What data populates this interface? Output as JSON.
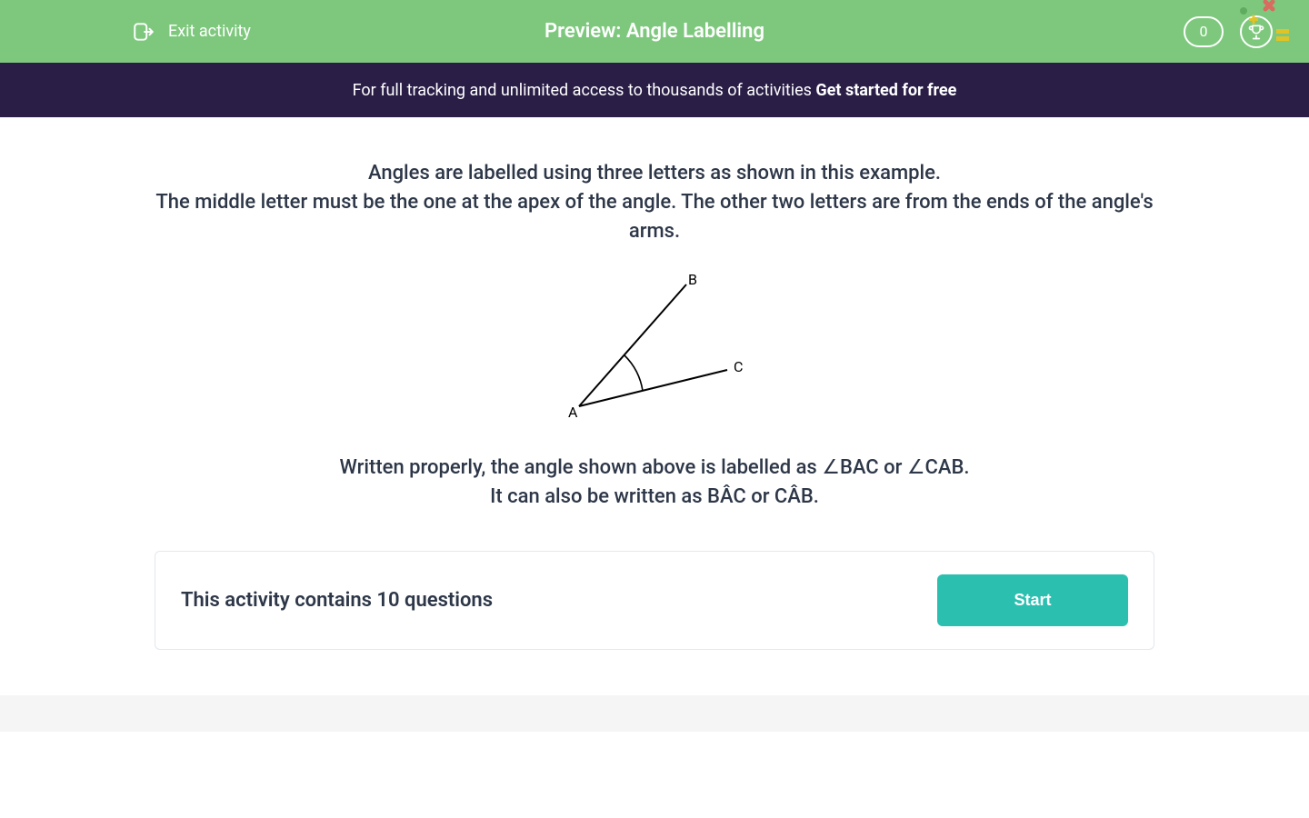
{
  "header": {
    "exit_label": "Exit activity",
    "title": "Preview: Angle Labelling",
    "score": "0"
  },
  "banner": {
    "prefix": "For full tracking and unlimited access to thousands of activities ",
    "cta": "Get started for free"
  },
  "content": {
    "intro_line1": "Angles are labelled using three letters as shown in this example.",
    "intro_line2": "The middle letter must be the one at the apex of the angle.  The other two letters are from the ends of the angle's arms.",
    "figure": {
      "label_A": "A",
      "label_B": "B",
      "label_C": "C"
    },
    "explain_line1": "Written properly, the angle shown above is labelled as ∠BAC or  ∠CAB.",
    "explain_line2": "It can also be written as BÂC or CÂB."
  },
  "card": {
    "question_count": "This activity contains 10 questions",
    "start_label": "Start"
  }
}
